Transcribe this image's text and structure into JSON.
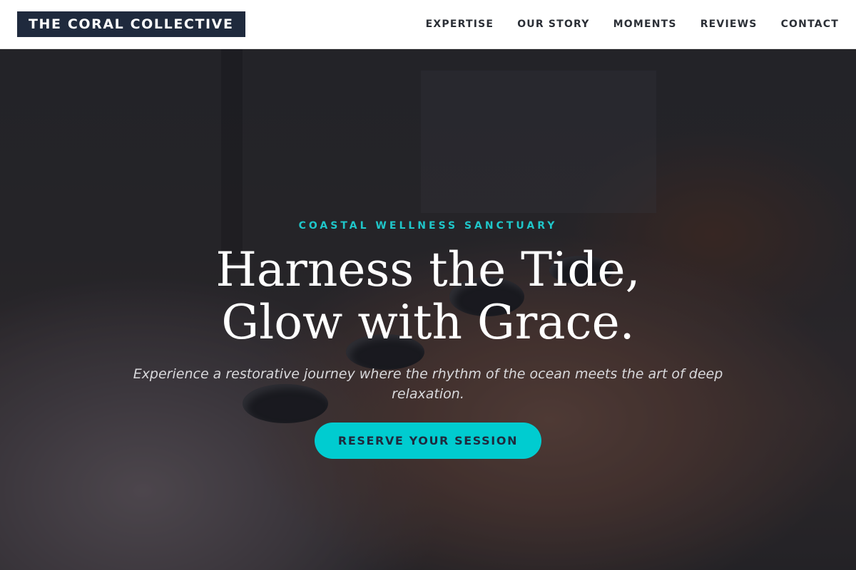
{
  "brand": {
    "name": "THE CORAL COLLECTIVE"
  },
  "nav": {
    "items": [
      "EXPERTISE",
      "OUR STORY",
      "MOMENTS",
      "REVIEWS",
      "CONTACT"
    ]
  },
  "hero": {
    "eyebrow": "COASTAL WELLNESS SANCTUARY",
    "headline_line1": "Harness the Tide,",
    "headline_line2": "Glow with Grace.",
    "subtitle": "Experience a restorative journey where the rhythm of the ocean meets the art of deep relaxation.",
    "cta_label": "RESERVE YOUR SESSION",
    "background_image": "hot-stone-massage-photo"
  },
  "colors": {
    "navy": "#1f2a3d",
    "accent_teal": "#00ccd0",
    "eyebrow_teal": "#1fc6c9",
    "nav_text": "#2b2f36"
  }
}
